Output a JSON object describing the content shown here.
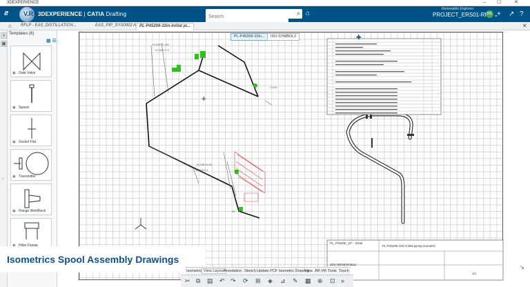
{
  "window": {
    "title": "3DEXPERIENCE",
    "minimize": "–",
    "maximize": "☐",
    "close": "✕"
  },
  "topbar": {
    "brand_main": "3DEXPERIENCE",
    "brand_sep": " | ",
    "brand_app": "CATIA",
    "brand_module": " Drafting",
    "search_placeholder": "Search",
    "user": "Renewable Engineer",
    "project": "PROJECT_ERS01-RPE ⌄",
    "avatar_initials": "RE"
  },
  "tabs": [
    {
      "label": "RFLP - EAS_DISTILLATION..."
    },
    {
      "label": "EAS_PIP_SYS0002 A.1"
    },
    {
      "label": "PL-P45206-10in-Initial pi..."
    }
  ],
  "panel": {
    "header": "Templates (6)",
    "items": [
      {
        "label": "Gate Valve"
      },
      {
        "label": "Spacer"
      },
      {
        "label": "Socket Flat"
      },
      {
        "label": "Transmitter"
      },
      {
        "label": "Flange WeldNeck"
      },
      {
        "label": "Hilpo Flange"
      }
    ]
  },
  "views": [
    {
      "label": "PL-P45206-10in..."
    },
    {
      "label": "ISO-SYMBOL2"
    }
  ],
  "bottom_tabs": [
    {
      "label": "Isometrics"
    },
    {
      "label": "View Layout"
    },
    {
      "label": "Annotation"
    },
    {
      "label": "Sketch"
    },
    {
      "label": "Update PCF Isometric Drawing"
    },
    {
      "label": "View"
    },
    {
      "label": "AR-VR"
    },
    {
      "label": "Tools"
    },
    {
      "label": "Touch"
    }
  ],
  "title_block": {
    "drawing_no": "PL_P45206_10\" - Initial",
    "title": "PL-P45206-10in-Initial piping Isometric",
    "company": "3DS RENEWABLE",
    "sheet": "1/1"
  },
  "caption": "Isometrics Spool Assembly Drawings",
  "colors": {
    "topbar": "#005386",
    "accent": "#0f4f8a",
    "pipe_green": "#2fbf1f",
    "hatch_red": "#d44"
  }
}
